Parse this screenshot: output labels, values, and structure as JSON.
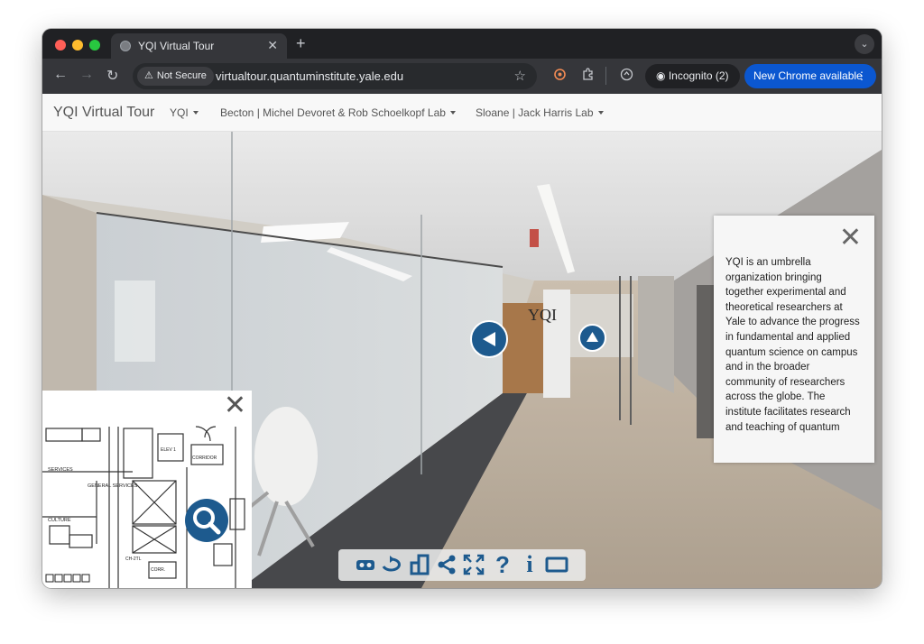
{
  "browser": {
    "tab": {
      "title": "YQI Virtual Tour",
      "close": "✕"
    },
    "new_tab": "+",
    "tab_menu": "⌄",
    "nav": {
      "back": "←",
      "forward": "→",
      "reload": "↻"
    },
    "address": {
      "security_label": "Not Secure",
      "warning_glyph": "⚠",
      "url": "virtualtour.quantuminstitute.yale.edu",
      "bookmark_glyph": "☆"
    },
    "incognito": {
      "label": "Incognito (2)"
    },
    "update": {
      "label": "New Chrome available",
      "menu_glyph": "⋮"
    },
    "accent_color": "#0b57d0"
  },
  "site": {
    "brand": "YQI Virtual Tour",
    "menus": [
      {
        "label": "YQI"
      },
      {
        "label": "Becton | Michel Devoret & Rob Schoelkopf Lab"
      },
      {
        "label": "Sloane | Jack Harris Lab"
      }
    ],
    "accent_color": "#1d5a8e"
  },
  "scene": {
    "wall_sign": "YQI",
    "hotspots": [
      {
        "icon": "arrow-left-icon"
      },
      {
        "icon": "arrow-up-icon"
      }
    ]
  },
  "info_panel": {
    "close": "✕",
    "text": "YQI is an umbrella organization bringing together experimental and theoretical researchers at Yale to advance the progress in fundamental and applied quantum science on campus and in the broader community of researchers across the globe. The institute facilitates research and teaching of quantum"
  },
  "minimap": {
    "close": "✕",
    "labels": [
      "SERVICES",
      "GENERAL SERVICES",
      "ELEV 1",
      "CORRIDOR",
      "CULTURE",
      "CH-2TL",
      "CORR."
    ],
    "zoom_icon": "magnifier-icon"
  },
  "controls": [
    {
      "name": "vr-mode-button",
      "icon": "vr-goggles-icon"
    },
    {
      "name": "autorotate-button",
      "icon": "rotate-360-icon"
    },
    {
      "name": "floorplan-button",
      "icon": "floorplan-icon"
    },
    {
      "name": "share-button",
      "icon": "share-icon"
    },
    {
      "name": "fullscreen-button",
      "icon": "fullscreen-icon"
    },
    {
      "name": "help-button",
      "icon": "question-icon",
      "glyph": "?"
    },
    {
      "name": "info-button",
      "icon": "info-icon",
      "glyph": "i"
    },
    {
      "name": "window-mode-button",
      "icon": "window-icon"
    }
  ]
}
